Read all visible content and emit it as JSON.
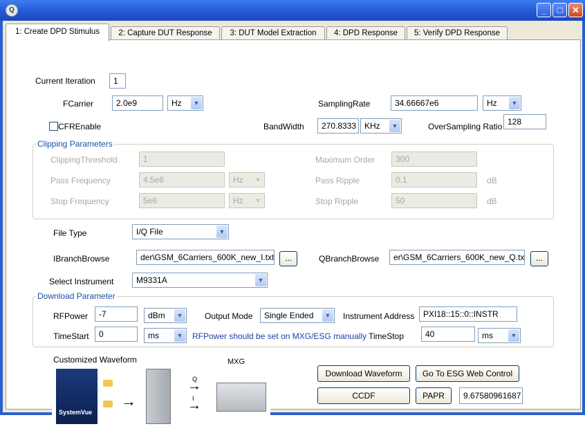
{
  "window": {
    "icon_glyph": "Q"
  },
  "tabs": [
    {
      "label": "1: Create DPD Stimulus"
    },
    {
      "label": "2: Capture DUT Response"
    },
    {
      "label": "3: DUT Model Extraction"
    },
    {
      "label": "4: DPD Response"
    },
    {
      "label": "5: Verify DPD Response"
    }
  ],
  "form": {
    "current_iteration": {
      "label": "Current Iteration",
      "value": "1"
    },
    "fcarrier": {
      "label": "FCarrier",
      "value": "2.0e9",
      "unit": "Hz"
    },
    "sampling_rate": {
      "label": "SamplingRate",
      "value": "34.66667e6",
      "unit": "Hz"
    },
    "cfr_enable": {
      "label": "CFREnable"
    },
    "bandwidth": {
      "label": "BandWidth",
      "value": "270.8333",
      "unit": "KHz"
    },
    "oversampling": {
      "label": "OverSampling Ratio",
      "value": "128"
    }
  },
  "clipping": {
    "title": "Clipping Parameters",
    "threshold": {
      "label": "ClippingThreshold",
      "value": "1"
    },
    "max_order": {
      "label": "Maximum Order",
      "value": "300"
    },
    "pass_freq": {
      "label": "Pass Frequency",
      "value": "4.5e6",
      "unit": "Hz"
    },
    "pass_ripple": {
      "label": "Pass Ripple",
      "value": "0.1",
      "unit": "dB"
    },
    "stop_freq": {
      "label": "Stop Frequency",
      "value": "5e6",
      "unit": "Hz"
    },
    "stop_ripple": {
      "label": "Stop Ripple",
      "value": "50",
      "unit": "dB"
    }
  },
  "file": {
    "type_label": "File Type",
    "type_value": "I/Q File",
    "ibranch_label": "IBranchBrowse",
    "ibranch_value": "der\\GSM_6Carriers_600K_new_I.txt",
    "qbranch_label": "QBranchBrowse",
    "qbranch_value": "er\\GSM_6Carriers_600K_new_Q.txt",
    "browse_label": "...",
    "instrument_label": "Select Instrument",
    "instrument_value": "M9331A"
  },
  "download": {
    "title": "Download Parameter",
    "rfpower": {
      "label": "RFPower",
      "value": "-7",
      "unit": "dBm"
    },
    "output_mode": {
      "label": "Output Mode",
      "value": "Single Ended"
    },
    "inst_addr": {
      "label": "Instrument Address",
      "value": "PXI18::15::0::INSTR"
    },
    "timestart": {
      "label": "TimeStart",
      "value": "0",
      "unit": "ms"
    },
    "note": "RFPower should be set on MXG/ESG manually",
    "timestop": {
      "label": "TimeStop",
      "value": "40",
      "unit": "ms"
    }
  },
  "waveform": {
    "title": "Customized Waveform",
    "mxg_label": "MXG",
    "q_label": "Q",
    "i_label": "I",
    "logo_text": "SystemVue"
  },
  "actions": {
    "download_label": "Download Waveform",
    "esg_label": "Go To ESG Web Control",
    "ccdf_label": "CCDF",
    "papr_label": "PAPR",
    "papr_value": "9.67580961687"
  },
  "colors": {
    "accent": "#1c4fa8",
    "titlebar": "#2456d4"
  }
}
